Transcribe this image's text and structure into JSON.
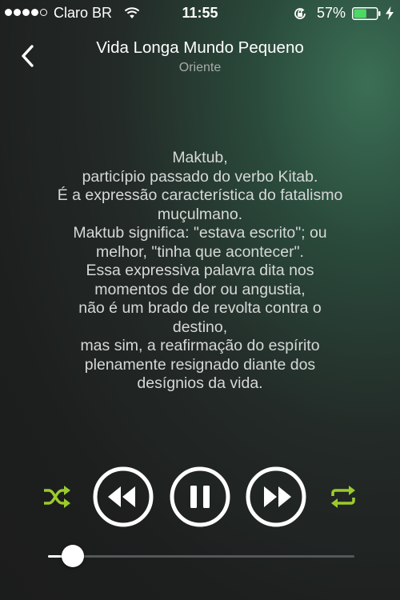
{
  "status_bar": {
    "carrier": "Claro BR",
    "time": "11:55",
    "battery_percent": "57%",
    "signal_bars_filled": 4,
    "signal_bars_total": 5,
    "battery_level": 0.57,
    "icons": [
      "signal-dots-icon",
      "wifi-icon",
      "rotation-lock-icon",
      "battery-icon",
      "charging-icon"
    ]
  },
  "header": {
    "back_icon": "chevron-left-icon",
    "title": "Vida Longa Mundo Pequeno",
    "artist": "Oriente"
  },
  "lyrics": {
    "lines": [
      "Maktub,",
      "particípio passado do verbo Kitab.",
      "É a expressão característica do fatalismo",
      "muçulmano.",
      "Maktub significa: \"estava escrito\"; ou",
      "melhor, \"tinha que acontecer\".",
      "Essa expressiva palavra dita nos",
      "momentos de dor ou angustia,",
      "não é um brado de revolta contra o",
      "destino,",
      "mas sim, a reafirmação do espírito",
      "plenamente resignado diante dos",
      "desígnios da vida."
    ]
  },
  "controls": {
    "shuffle_icon": "shuffle-icon",
    "previous_icon": "rewind-icon",
    "pause_icon": "pause-icon",
    "next_icon": "fast-forward-icon",
    "repeat_icon": "repeat-icon"
  },
  "playback": {
    "progress": 0.08
  },
  "colors": {
    "accent": "#9ccb2c",
    "battery": "#4cd964",
    "text_secondary": "#a8aba9"
  }
}
